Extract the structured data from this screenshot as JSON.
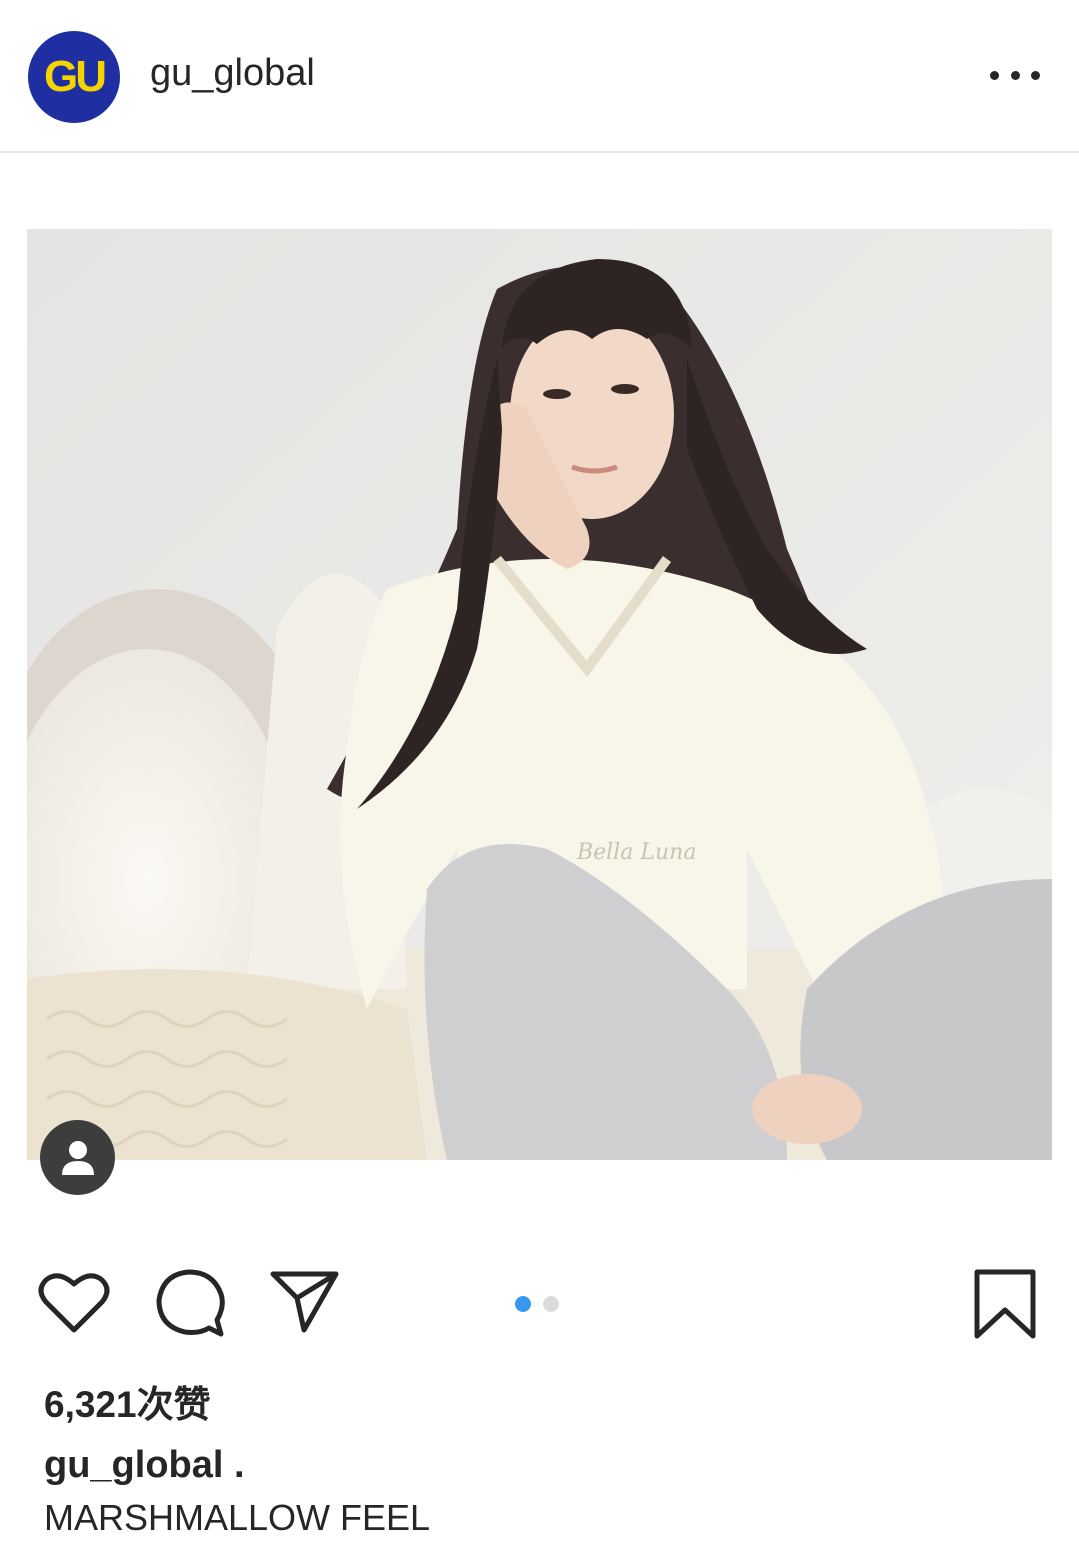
{
  "post": {
    "username": "gu_global",
    "avatar_text": "GU",
    "more_icon": "more-horizontal-icon",
    "likes_text": "6,321次赞",
    "caption_user": "gu_global .",
    "caption_text": "MARSHMALLOW FEEL",
    "carousel": {
      "count": 2,
      "active_index": 0
    }
  },
  "colors": {
    "avatar_bg": "#1f2ea0",
    "avatar_text": "#f5d400",
    "active_dot": "#3897f0",
    "inactive_dot": "#dbdbdb"
  },
  "icons": [
    "heart-icon",
    "comment-icon",
    "share-icon",
    "bookmark-icon",
    "user-tag-icon"
  ]
}
